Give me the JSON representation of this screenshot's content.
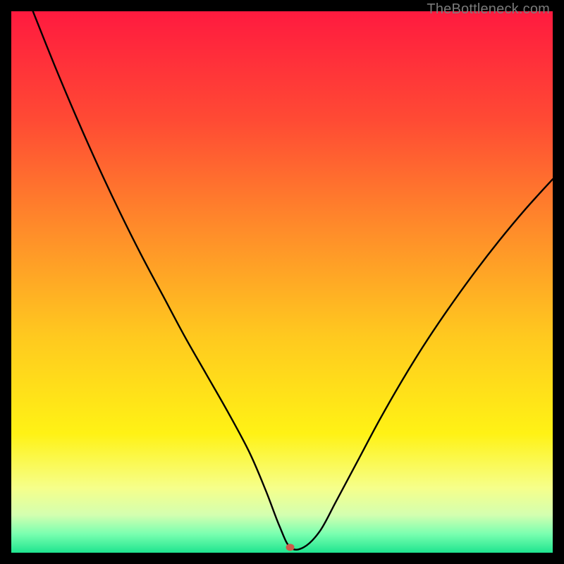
{
  "watermark": "TheBottleneck.com",
  "chart_data": {
    "type": "line",
    "title": "",
    "xlabel": "",
    "ylabel": "",
    "xlim": [
      0,
      100
    ],
    "ylim": [
      0,
      100
    ],
    "grid": false,
    "legend": false,
    "background_gradient_stops": [
      {
        "offset": 0.0,
        "color": "#ff1a3f"
      },
      {
        "offset": 0.2,
        "color": "#ff4a34"
      },
      {
        "offset": 0.4,
        "color": "#ff8b2a"
      },
      {
        "offset": 0.6,
        "color": "#ffc91f"
      },
      {
        "offset": 0.78,
        "color": "#fff215"
      },
      {
        "offset": 0.88,
        "color": "#f6ff8a"
      },
      {
        "offset": 0.93,
        "color": "#d4ffb0"
      },
      {
        "offset": 0.965,
        "color": "#7affb0"
      },
      {
        "offset": 1.0,
        "color": "#1fe58f"
      }
    ],
    "marker": {
      "x": 51.5,
      "y": 1.0,
      "color": "#cc5a4a"
    },
    "series": [
      {
        "name": "curve",
        "x": [
          4.0,
          8.0,
          12.0,
          16.0,
          20.0,
          24.0,
          28.0,
          32.0,
          36.0,
          40.0,
          44.0,
          47.0,
          49.5,
          51.5,
          54.0,
          57.0,
          60.0,
          64.0,
          68.0,
          72.0,
          76.0,
          80.0,
          85.0,
          90.0,
          95.0,
          100.0
        ],
        "y": [
          100.0,
          90.0,
          80.5,
          71.5,
          63.0,
          55.0,
          47.5,
          40.0,
          33.0,
          26.0,
          18.5,
          11.5,
          5.0,
          1.0,
          1.0,
          4.0,
          9.5,
          17.0,
          24.5,
          31.5,
          38.0,
          44.0,
          51.0,
          57.5,
          63.5,
          69.0
        ]
      }
    ]
  }
}
